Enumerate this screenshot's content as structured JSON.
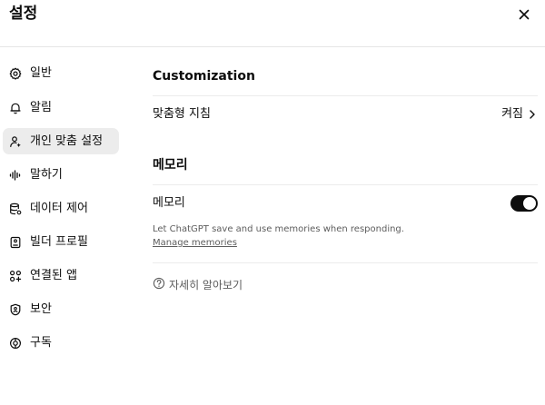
{
  "header": {
    "title": "설정",
    "close_icon": "close-icon"
  },
  "sidebar": {
    "items": [
      {
        "label": "일반",
        "icon": "gear-icon",
        "active": false
      },
      {
        "label": "알림",
        "icon": "bell-icon",
        "active": false
      },
      {
        "label": "개인 맞춤 설정",
        "icon": "personalization-icon",
        "active": true
      },
      {
        "label": "말하기",
        "icon": "waveform-icon",
        "active": false
      },
      {
        "label": "데이터 제어",
        "icon": "database-icon",
        "active": false
      },
      {
        "label": "빌더 프로필",
        "icon": "id-card-icon",
        "active": false
      },
      {
        "label": "연결된 앱",
        "icon": "apps-grid-icon",
        "active": false
      },
      {
        "label": "보안",
        "icon": "shield-icon",
        "active": false
      },
      {
        "label": "구독",
        "icon": "subscription-icon",
        "active": false
      }
    ]
  },
  "main": {
    "customization": {
      "title": "Customization",
      "instructions_label": "맞춤형 지침",
      "instructions_value": "켜짐"
    },
    "memory": {
      "title": "메모리",
      "toggle_label": "메모리",
      "toggle_on": true,
      "description": "Let ChatGPT save and use memories when responding.",
      "manage_link": "Manage memories"
    },
    "learn_more": "자세히 알아보기"
  },
  "colors": {
    "text": "#0d0d0d",
    "secondary_text": "#5d5d5d",
    "active_background": "#ececec",
    "toggle_on": "#0d0d0d"
  }
}
